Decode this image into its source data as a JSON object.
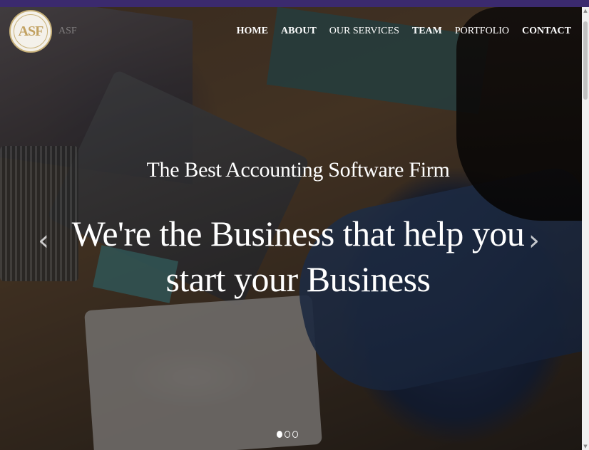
{
  "logo": {
    "text": "ASF",
    "side_text": "ASF"
  },
  "nav": {
    "items": [
      {
        "label": "HOME"
      },
      {
        "label": "ABOUT"
      },
      {
        "label": "OUR SERVICES"
      },
      {
        "label": "TEAM"
      },
      {
        "label": "PORTFOLIO"
      },
      {
        "label": "CONTACT"
      }
    ]
  },
  "hero": {
    "subtitle": "The Best Accounting Software Firm",
    "headline": "We're the Business that help you start your Business",
    "prev_icon": "‹",
    "next_icon": "›"
  },
  "carousel": {
    "slide_count": 3,
    "active_index": 0
  },
  "colors": {
    "topbar": "#3b2a6e",
    "logo_gold": "#c2a262",
    "text": "#ffffff"
  }
}
